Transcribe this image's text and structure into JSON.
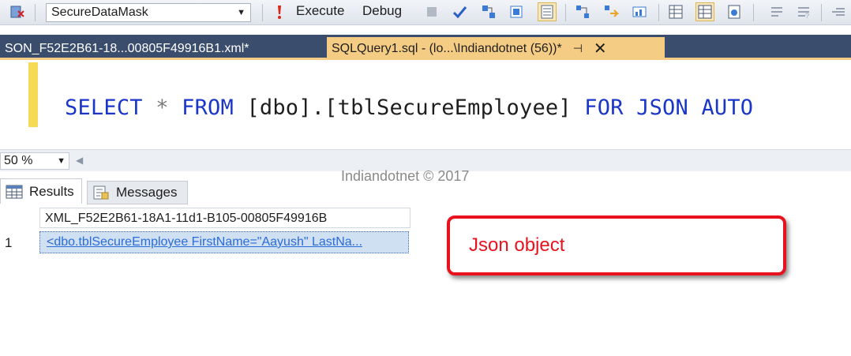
{
  "toolbar": {
    "database": "SecureDataMask",
    "execute_label": "Execute",
    "debug_label": "Debug"
  },
  "tabs": {
    "inactive_label": "SON_F52E2B61-18...00805F49916B1.xml*",
    "active_label": "SQLQuery1.sql - (lo...\\Indiandotnet (56))*",
    "pin_glyph": "⊣",
    "close_glyph": "✕"
  },
  "editor": {
    "kw_select": "SELECT",
    "op_star": "*",
    "kw_from": "FROM",
    "table_ref": "[dbo].[tblSecureEmployee]",
    "kw_for": "FOR",
    "kw_json": "JSON",
    "kw_auto": "AUTO"
  },
  "zoom": {
    "value": "50 %"
  },
  "watermark": "Indiandotnet © 2017",
  "results": {
    "tab_results": "Results",
    "tab_messages": "Messages",
    "column_header": "XML_F52E2B61-18A1-11d1-B105-00805F49916B",
    "rows": [
      {
        "num": "1",
        "value": "<dbo.tblSecureEmployee FirstName=\"Aayush\" LastNa..."
      }
    ]
  },
  "callout": {
    "text": "Json object"
  },
  "colors": {
    "tab_strip": "#3a4d6c",
    "active_tab": "#f5cc84",
    "keyword": "#1a36c9",
    "callout": "#e8121f"
  }
}
